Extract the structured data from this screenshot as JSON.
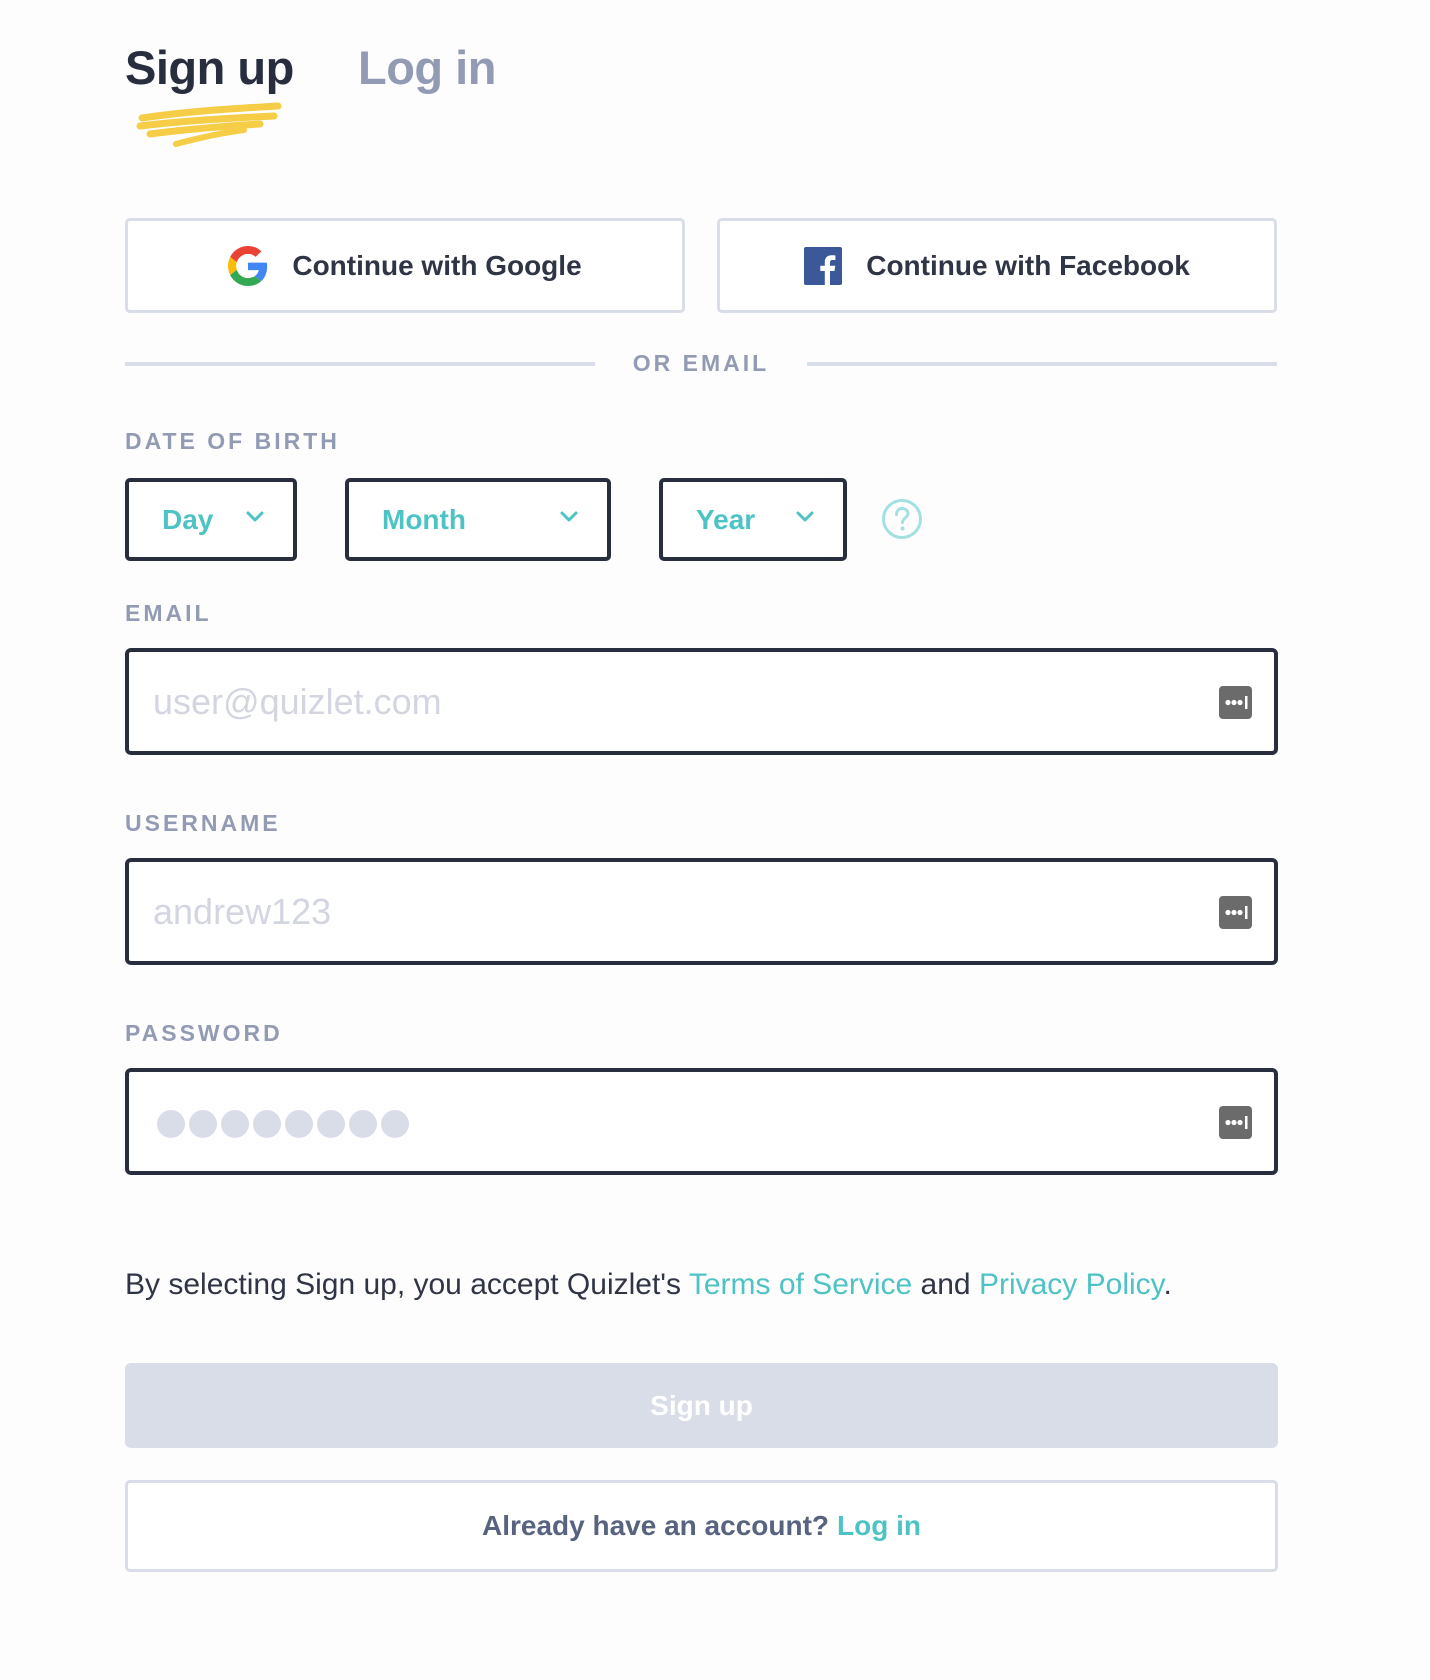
{
  "tabs": {
    "signup_label": "Sign up",
    "login_label": "Log in"
  },
  "social": {
    "google_label": "Continue with Google",
    "facebook_label": "Continue with Facebook"
  },
  "divider": {
    "text": "OR EMAIL"
  },
  "dob": {
    "label": "DATE OF BIRTH",
    "day": "Day",
    "month": "Month",
    "year": "Year"
  },
  "email": {
    "label": "EMAIL",
    "placeholder": "user@quizlet.com",
    "value": ""
  },
  "username": {
    "label": "USERNAME",
    "placeholder": "andrew123",
    "value": ""
  },
  "password": {
    "label": "PASSWORD",
    "masked_length": 8
  },
  "terms": {
    "prefix": "By selecting Sign up, you accept Quizlet's ",
    "tos": "Terms of Service",
    "and": " and ",
    "privacy": "Privacy Policy",
    "suffix": "."
  },
  "signup_button": {
    "label": "Sign up",
    "enabled": false
  },
  "login_prompt": {
    "text": "Already have an account?",
    "link": "Log in"
  },
  "colors": {
    "accent": "#4ec3c5",
    "scribble": "#f5cd47",
    "facebook": "#3b5998",
    "muted": "#939bb4",
    "border_dark": "#282e3e",
    "border_light": "#d9dde8"
  }
}
